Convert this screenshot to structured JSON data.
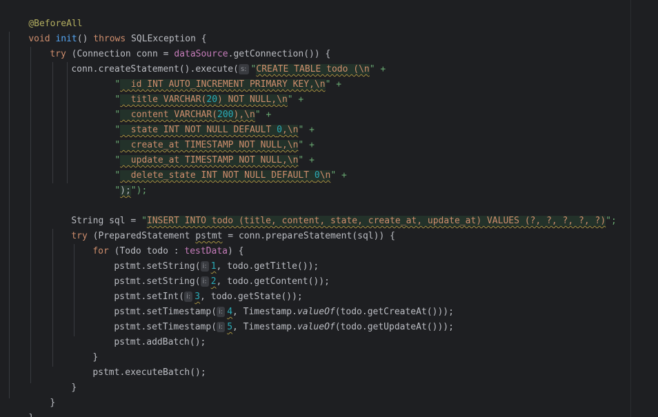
{
  "code": {
    "l1_annotation": "@BeforeAll",
    "l2_void": "void",
    "l2_method": "init",
    "l2_parens": "() ",
    "l2_throws": "throws",
    "l2_rest": " SQLException {",
    "l3_try": "try",
    "l3_a": " (Connection conn = ",
    "l3_field": "dataSource",
    "l3_b": ".getConnection()) {",
    "l4_a": "conn.createStatement().execute(",
    "l4_hint": "s:",
    "l4_q": "\"",
    "l4_sql": "CREATE TABLE todo (\\n",
    "l4_end": "\" +",
    "l5_q": "\"",
    "l5_sql_a": "  id INT AUTO_INCREMENT PRIMARY KEY,\\n",
    "l5_end": "\" +",
    "l6_q": "\"",
    "l6_sql_a": "  title VARCHAR(",
    "l6_num": "20",
    "l6_sql_b": ") NOT NULL,\\n",
    "l6_end": "\" +",
    "l7_q": "\"",
    "l7_sql_a": "  content VARCHAR(",
    "l7_num": "200",
    "l7_sql_b": "),\\n",
    "l7_end": "\" +",
    "l8_q": "\"",
    "l8_sql_a": "  state INT NOT NULL DEFAULT ",
    "l8_num": "0",
    "l8_sql_b": ",\\n",
    "l8_end": "\" +",
    "l9_q": "\"",
    "l9_sql_a": "  create_at TIMESTAMP NOT NULL,\\n",
    "l9_end": "\" +",
    "l10_q": "\"",
    "l10_sql_a": "  update_at TIMESTAMP NOT NULL,\\n",
    "l10_end": "\" +",
    "l11_q": "\"",
    "l11_sql_a": "  delete_state INT NOT NULL DEFAULT ",
    "l11_num": "0",
    "l11_sql_b": "\\n",
    "l11_end": "\" +",
    "l12_q": "\"",
    "l12_sql": ");",
    "l12_end": "\");",
    "l14_a": "String sql = ",
    "l14_q": "\"",
    "l14_sql": "INSERT INTO todo (title, content, state, create_at, update_at) VALUES (?, ?, ?, ?, ?)",
    "l14_end": "\";",
    "l15_try": "try",
    "l15_a": " (PreparedStatement ",
    "l15_var": "pstmt",
    "l15_b": " = conn.prepareStatement(sql)) {",
    "l16_for": "for",
    "l16_a": " (Todo todo : ",
    "l16_field": "testData",
    "l16_b": ") {",
    "l17_a": "pstmt.setString(",
    "l17_hint": "i:",
    "l17_num": "1",
    "l17_b": ", todo.getTitle());",
    "l18_a": "pstmt.setString(",
    "l18_hint": "i:",
    "l18_num": "2",
    "l18_b": ", todo.getContent());",
    "l19_a": "pstmt.setInt(",
    "l19_hint": "i:",
    "l19_num": "3",
    "l19_b": ", todo.getState());",
    "l20_a": "pstmt.setTimestamp(",
    "l20_hint": "i:",
    "l20_num": "4",
    "l20_b": ", Timestamp.",
    "l20_static": "valueOf",
    "l20_c": "(todo.getCreateAt()));",
    "l21_a": "pstmt.setTimestamp(",
    "l21_hint": "i:",
    "l21_num": "5",
    "l21_b": ", Timestamp.",
    "l21_static": "valueOf",
    "l21_c": "(todo.getUpdateAt()));",
    "l22_a": "pstmt.addBatch();",
    "l23_a": "}",
    "l24_a": "pstmt.executeBatch();",
    "l25_a": "}",
    "l26_a": "}",
    "l27_a": "}"
  },
  "colors": {
    "background": "#1e1f22",
    "keyword": "#cf8e6d",
    "string": "#6aab73",
    "number": "#2aacb8",
    "method": "#56a8f5",
    "field": "#c77dbb",
    "annotation": "#b3ae60",
    "text": "#bcbec4"
  }
}
